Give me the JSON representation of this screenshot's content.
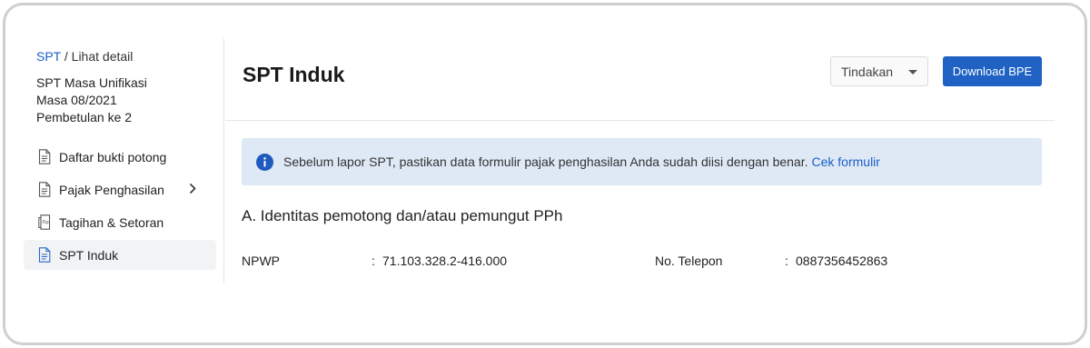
{
  "breadcrumb": {
    "link": "SPT",
    "separator": " / ",
    "current": "Lihat detail"
  },
  "spt_meta": {
    "title": "SPT Masa Unifikasi",
    "period": "Masa 08/2021",
    "revision": "Pembetulan ke 2"
  },
  "sidebar": {
    "items": [
      {
        "label": "Daftar bukti potong",
        "icon": "document-icon"
      },
      {
        "label": "Pajak Penghasilan",
        "icon": "document-icon"
      },
      {
        "label": "Tagihan & Setoran",
        "icon": "receipt-icon"
      },
      {
        "label": "SPT Induk",
        "icon": "document-icon"
      }
    ]
  },
  "header": {
    "title": "SPT Induk",
    "action_select": "Tindakan",
    "download_label": "Download BPE"
  },
  "alert": {
    "message": "Sebelum lapor SPT, pastikan data formulir pajak penghasilan Anda sudah diisi dengan benar.",
    "link": "Cek formulir"
  },
  "section": {
    "title": "A. Identitas pemotong dan/atau pemungut PPh",
    "fields": [
      {
        "label": "NPWP",
        "separator": ":",
        "value": "71.103.328.2-416.000"
      },
      {
        "label": "No. Telepon",
        "separator": ":",
        "value": "0887356452863"
      }
    ]
  },
  "colors": {
    "accent": "#1f62c4",
    "alert_bg": "#dfe9f5",
    "active_bg": "#f1f3f5"
  }
}
